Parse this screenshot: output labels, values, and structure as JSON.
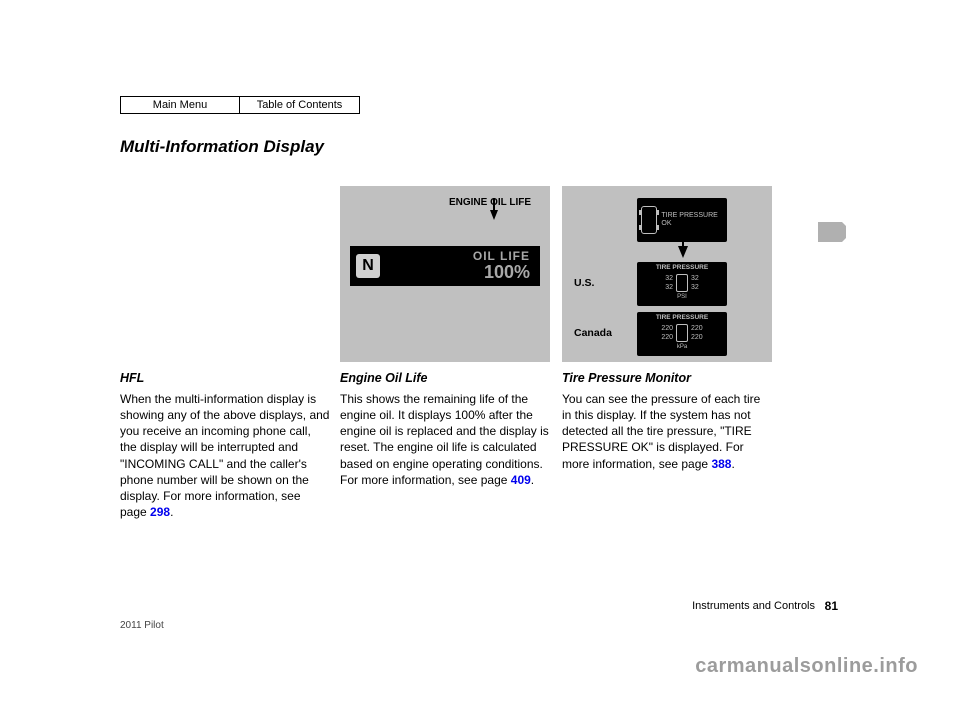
{
  "nav": {
    "main_menu": "Main Menu",
    "toc": "Table of Contents"
  },
  "title": "Multi-Information Display",
  "col1": {
    "heading": "HFL",
    "p1": "When the multi-information display is showing any of the above displays, and you receive an incoming phone call, the display will be interrupted and \"INCOMING CALL\" and the caller's phone number will be shown on the display. For more information, see page",
    "p1_page": "298",
    "p1_suffix": "."
  },
  "col2": {
    "fig_label": "ENGINE OIL LIFE",
    "lcd_gear": "N",
    "lcd_label": "OIL LIFE",
    "lcd_value": "100%",
    "heading": "Engine Oil Life",
    "p1": "This shows the remaining life of the engine oil. It displays 100% after the engine oil is replaced and the display is reset. The engine oil life is calculated based on engine operating conditions. For more information, see page",
    "p1_page": "409",
    "p1_suffix": "."
  },
  "col3": {
    "region_us": "U.S.",
    "region_ca": "Canada",
    "ok_text": "TIRE PRESSURE OK",
    "psi_head": "TIRE PRESSURE",
    "psi_vals": {
      "fl": "32",
      "fr": "32",
      "rl": "32",
      "rr": "32"
    },
    "psi_unit": "PSI",
    "kpa_head": "TIRE PRESSURE",
    "kpa_vals": {
      "fl": "220",
      "fr": "220",
      "rl": "220",
      "rr": "220"
    },
    "kpa_unit": "kPa",
    "heading": "Tire Pressure Monitor",
    "p1": "You can see the pressure of each tire in this display. If the system has not detected all the tire pressure, \"TIRE PRESSURE OK\" is displayed. For more information, see page",
    "p1_page": "388",
    "p1_suffix": "."
  },
  "footer": {
    "section": "Instruments and Controls",
    "page": "81",
    "date": "2011 Pilot"
  },
  "watermark": "carmanualsonline.info"
}
